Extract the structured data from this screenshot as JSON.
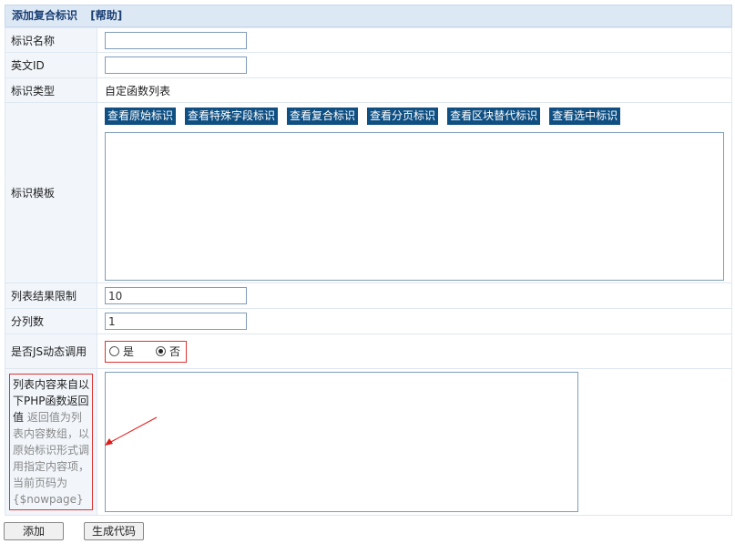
{
  "header": {
    "title": "添加复合标识",
    "help": "[帮助]"
  },
  "form": {
    "name_label": "标识名称",
    "name_value": "",
    "english_id_label": "英文ID",
    "english_id_value": "",
    "type_label": "标识类型",
    "type_value": "自定函数列表",
    "template_label": "标识模板",
    "template_buttons": [
      "查看原始标识",
      "查看特殊字段标识",
      "查看复合标识",
      "查看分页标识",
      "查看区块替代标识",
      "查看选中标识"
    ],
    "limit_label": "列表结果限制",
    "limit_value": "10",
    "columns_label": "分列数",
    "columns_value": "1",
    "js_label": "是否JS动态调用",
    "js_yes": "是",
    "js_no": "否",
    "js_selected": "否",
    "php_label_main": "列表内容来自以下PHP函数返回值",
    "php_label_hint": "返回值为列表内容数组，以原始标识形式调用指定内容项，当前页码为{$nowpage}"
  },
  "buttons": {
    "add": "添加",
    "generate": "生成代码"
  },
  "colors": {
    "header_bg": "#dde8f5",
    "header_text": "#1a3f73",
    "button_bg": "#0f4f82",
    "highlight_border": "#d33333"
  }
}
